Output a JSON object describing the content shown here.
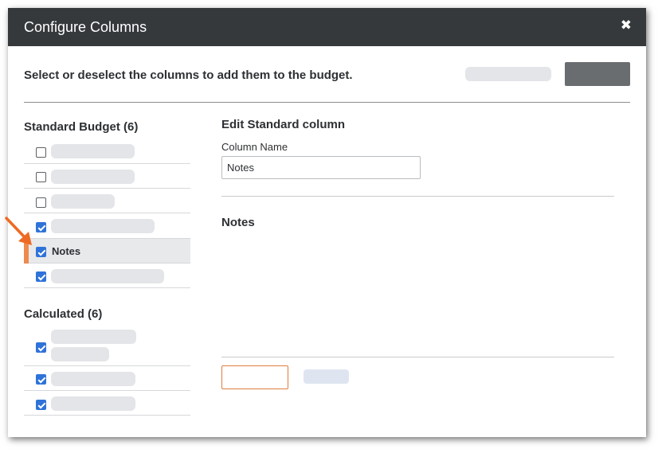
{
  "modal": {
    "title": "Configure Columns",
    "close_glyph": "✖",
    "instruction": "Select or deselect the columns to add them to the budget."
  },
  "standard_section": {
    "heading": "Standard Budget (6)",
    "rows": [
      {
        "checked": false,
        "label": ""
      },
      {
        "checked": false,
        "label": ""
      },
      {
        "checked": false,
        "label": ""
      },
      {
        "checked": true,
        "label": ""
      },
      {
        "checked": true,
        "label": "Notes",
        "selected": true
      },
      {
        "checked": true,
        "label": ""
      }
    ]
  },
  "calculated_section": {
    "heading": "Calculated (6)",
    "rows": [
      {
        "checked": true,
        "label": ""
      },
      {
        "checked": true,
        "label": ""
      },
      {
        "checked": true,
        "label": ""
      }
    ]
  },
  "editor": {
    "title": "Edit Standard column",
    "column_name_label": "Column Name",
    "column_name_value": "Notes",
    "notes_heading": "Notes"
  },
  "colors": {
    "header_bg": "#35393c",
    "checkbox_checked": "#2f73d8",
    "highlight_orange": "#ee8a4e"
  }
}
